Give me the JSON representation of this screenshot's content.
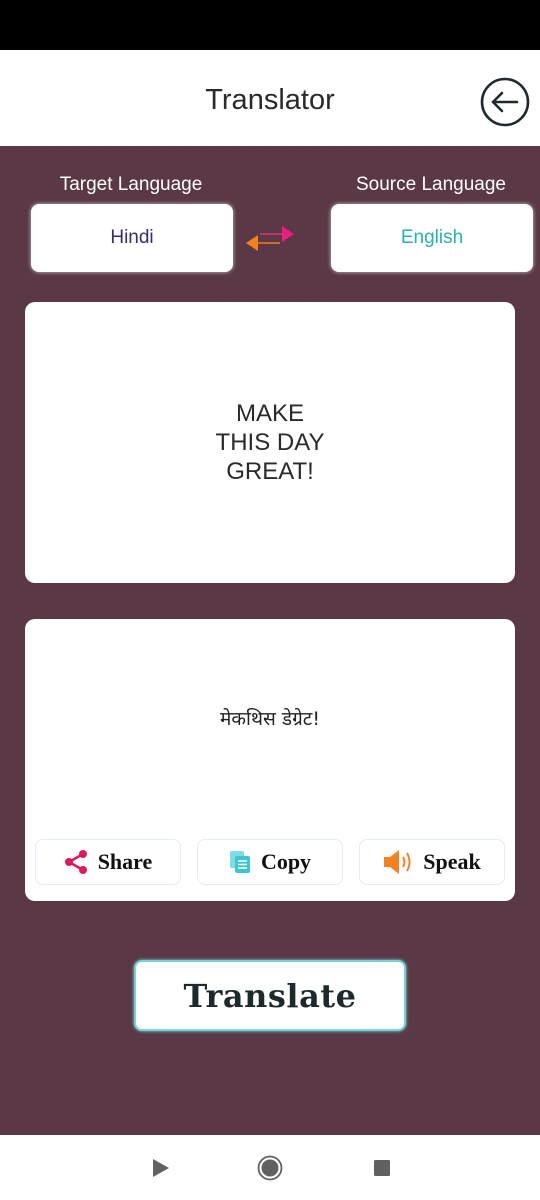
{
  "app_bar": {
    "title": "Translator",
    "back_icon": "arrow-left-circle-icon"
  },
  "languages": {
    "target_label": "Target Language",
    "target_value": "Hindi",
    "source_label": "Source Language",
    "source_value": "English",
    "swap_icon": "swap-arrows-icon",
    "colors": {
      "target_text": "#3d2a6b",
      "source_text": "#2bb0b0",
      "swap_left": "#f5821f",
      "swap_right": "#ee1c7a"
    }
  },
  "input": {
    "text": "MAKE\nTHIS DAY\nGREAT!"
  },
  "output": {
    "text": "मेकथिस डेग्रेट!"
  },
  "actions": [
    {
      "label": "Share",
      "icon": "share-icon",
      "color": "#e0195a"
    },
    {
      "label": "Copy",
      "icon": "copy-icon",
      "color": "#3ec6d4"
    },
    {
      "label": "Speak",
      "icon": "speaker-icon",
      "color": "#f5821f"
    }
  ],
  "translate_button": {
    "label": "Translate"
  },
  "nav_bar": {
    "back_icon": "nav-back-icon",
    "home_icon": "nav-home-icon",
    "recents_icon": "nav-recents-icon"
  },
  "theme": {
    "background": "#5a3845"
  }
}
